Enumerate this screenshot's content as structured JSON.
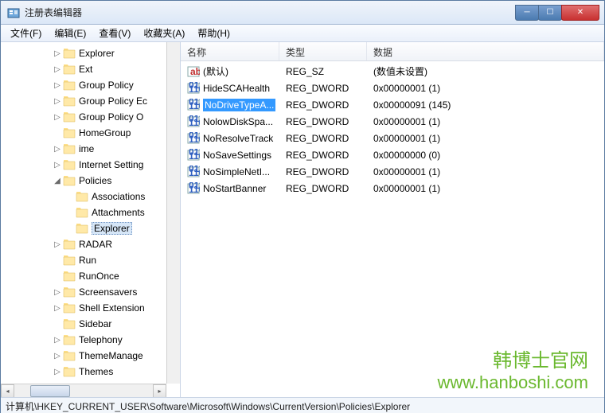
{
  "window": {
    "title": "注册表编辑器"
  },
  "menu": {
    "file": "文件(F)",
    "edit": "编辑(E)",
    "view": "查看(V)",
    "favorites": "收藏夹(A)",
    "help": "帮助(H)"
  },
  "tree": {
    "items": [
      {
        "label": "Explorer",
        "depth": 4,
        "exp": "▷"
      },
      {
        "label": "Ext",
        "depth": 4,
        "exp": "▷"
      },
      {
        "label": "Group Policy",
        "depth": 4,
        "exp": "▷"
      },
      {
        "label": "Group Policy Ec",
        "depth": 4,
        "exp": "▷"
      },
      {
        "label": "Group Policy O",
        "depth": 4,
        "exp": "▷"
      },
      {
        "label": "HomeGroup",
        "depth": 4,
        "exp": ""
      },
      {
        "label": "ime",
        "depth": 4,
        "exp": "▷"
      },
      {
        "label": "Internet Setting",
        "depth": 4,
        "exp": "▷"
      },
      {
        "label": "Policies",
        "depth": 4,
        "exp": "◢"
      },
      {
        "label": "Associations",
        "depth": 5,
        "exp": ""
      },
      {
        "label": "Attachments",
        "depth": 5,
        "exp": ""
      },
      {
        "label": "Explorer",
        "depth": 5,
        "exp": "",
        "selected": true
      },
      {
        "label": "RADAR",
        "depth": 4,
        "exp": "▷"
      },
      {
        "label": "Run",
        "depth": 4,
        "exp": ""
      },
      {
        "label": "RunOnce",
        "depth": 4,
        "exp": ""
      },
      {
        "label": "Screensavers",
        "depth": 4,
        "exp": "▷"
      },
      {
        "label": "Shell Extension",
        "depth": 4,
        "exp": "▷"
      },
      {
        "label": "Sidebar",
        "depth": 4,
        "exp": ""
      },
      {
        "label": "Telephony",
        "depth": 4,
        "exp": "▷"
      },
      {
        "label": "ThemeManage",
        "depth": 4,
        "exp": "▷"
      },
      {
        "label": "Themes",
        "depth": 4,
        "exp": "▷"
      }
    ]
  },
  "list": {
    "headers": {
      "name": "名称",
      "type": "类型",
      "data": "数据"
    },
    "rows": [
      {
        "icon": "sz",
        "name": "(默认)",
        "type": "REG_SZ",
        "data": "(数值未设置)"
      },
      {
        "icon": "dw",
        "name": "HideSCAHealth",
        "type": "REG_DWORD",
        "data": "0x00000001 (1)"
      },
      {
        "icon": "dw",
        "name": "NoDriveTypeA...",
        "type": "REG_DWORD",
        "data": "0x00000091 (145)",
        "selected": true
      },
      {
        "icon": "dw",
        "name": "NolowDiskSpa...",
        "type": "REG_DWORD",
        "data": "0x00000001 (1)"
      },
      {
        "icon": "dw",
        "name": "NoResolveTrack",
        "type": "REG_DWORD",
        "data": "0x00000001 (1)"
      },
      {
        "icon": "dw",
        "name": "NoSaveSettings",
        "type": "REG_DWORD",
        "data": "0x00000000 (0)"
      },
      {
        "icon": "dw",
        "name": "NoSimpleNetI...",
        "type": "REG_DWORD",
        "data": "0x00000001 (1)"
      },
      {
        "icon": "dw",
        "name": "NoStartBanner",
        "type": "REG_DWORD",
        "data": "0x00000001 (1)"
      }
    ]
  },
  "statusbar": {
    "path": "计算机\\HKEY_CURRENT_USER\\Software\\Microsoft\\Windows\\CurrentVersion\\Policies\\Explorer"
  },
  "watermark": {
    "cn": "韩博士官网",
    "url": "www.hanboshi.com"
  }
}
